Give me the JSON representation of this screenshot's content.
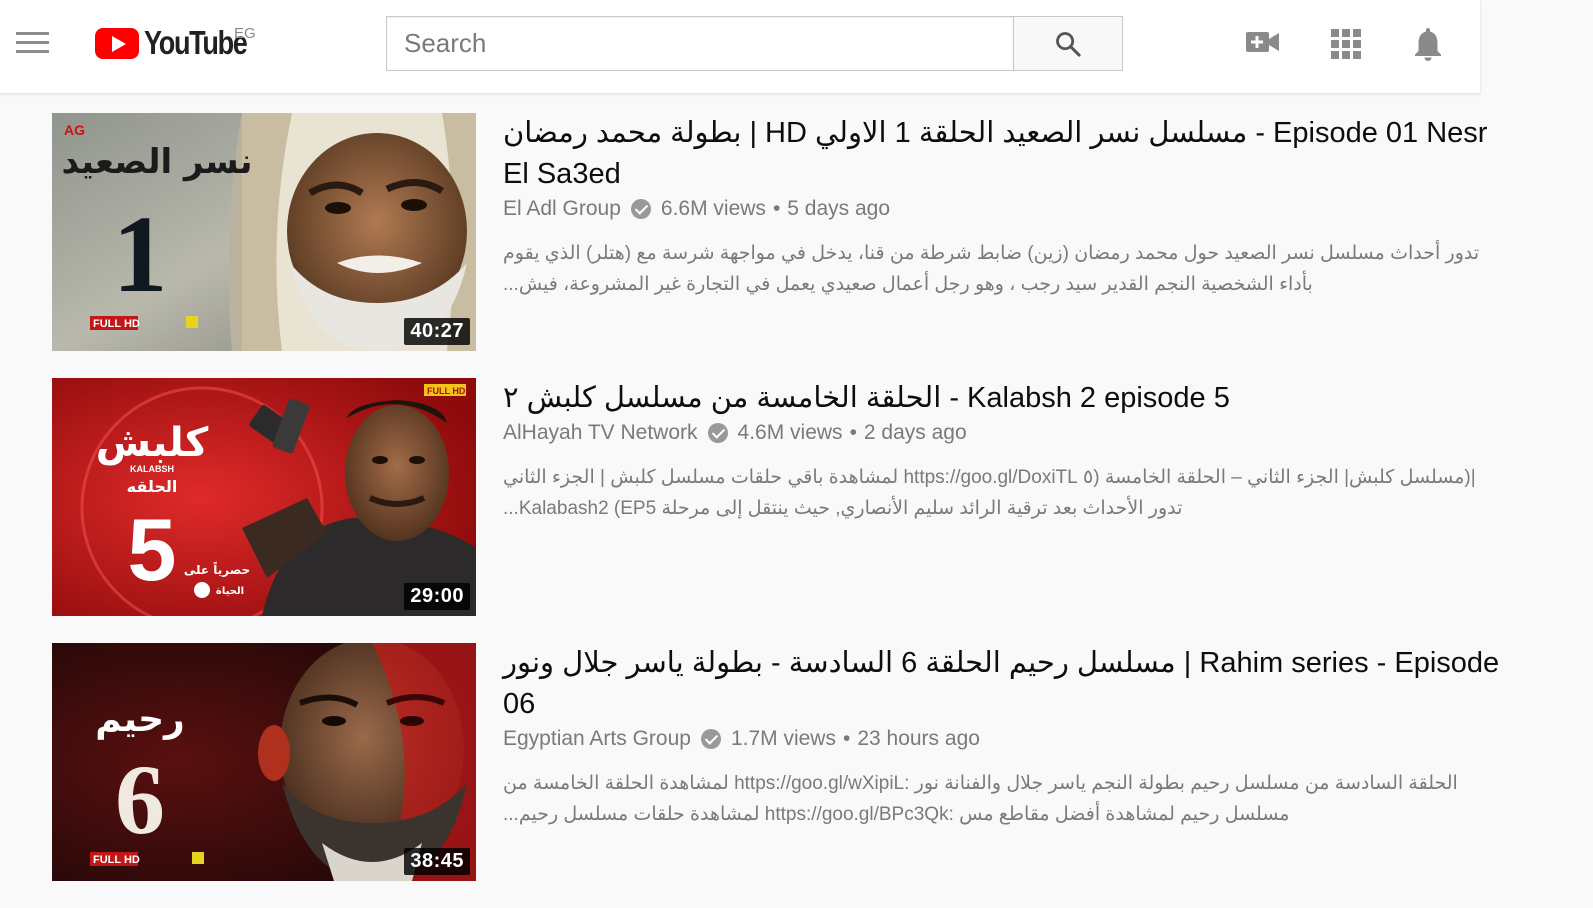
{
  "header": {
    "logo_text": "YouTube",
    "country_code": "EG",
    "search_placeholder": "Search",
    "brand_color": "#ff0000",
    "icons": [
      "menu-icon",
      "search-icon",
      "video-camera-plus-icon",
      "apps-grid-icon",
      "bell-icon"
    ]
  },
  "results": [
    {
      "title": "بطولة محمد رمضان | HD مسلسل نسر الصعيد الحلقة 1 الاولي - Episode 01 Nesr El Sa3ed",
      "channel": "El Adl Group",
      "views": "6.6M views",
      "age": "5 days ago",
      "description": "تدور أحداث مسلسل نسر الصعيد حول محمد رمضان (زين) ضابط شرطة من قنا، يدخل في مواجهة شرسة مع (هتلر) الذي يقوم بأداء الشخصية النجم القدير سيد رجب ، وهو رجل أعمال صعيدي يعمل في التجارة غير المشروعة، فيش...",
      "duration": "40:27",
      "thumb_text": "نسر الصعيد",
      "thumb_number": "1",
      "thumb_badges": [
        "AG",
        "FULL HD"
      ]
    },
    {
      "title": "الحلقة الخامسة من مسلسل كلبش ٢ - Kalabsh 2 episode 5",
      "channel": "AlHayah TV Network",
      "views": "4.6M views",
      "age": "2 days ago",
      "description": "|(مسلسل كلبش| الجزء الثاني – الحلقة الخامسة (٥ https://goo.gl/DoxiTL لمشاهدة باقي حلقات مسلسل كلبش | الجزء الثاني تدور الأحداث بعد ترقية الرائد سليم الأنصاري, حيث ينتقل إلى مرحلة Kalabash2 (EP5...",
      "duration": "29:00",
      "thumb_text": "كلبش",
      "thumb_sub": "KALABSH",
      "thumb_label": "الحلقه",
      "thumb_number": "5",
      "thumb_excl": "حصرياً على",
      "thumb_channel": "الحياة",
      "thumb_badges": [
        "FULL HD"
      ]
    },
    {
      "title": "مسلسل رحيم الحلقة 6 السادسة - بطولة ياسر جلال ونور | Rahim series - Episode 06",
      "channel": "Egyptian Arts Group",
      "views": "1.7M views",
      "age": "23 hours ago",
      "description": "الحلقة السادسة من مسلسل رحيم بطولة النجم ياسر جلال والفنانة نور :https://goo.gl/wXipiL لمشاهدة الحلقة الخامسة من مسلسل رحيم لمشاهدة أفضل مقاطع مس :https://goo.gl/BPc3Qk لمشاهدة حلقات مسلسل رحيم...",
      "duration": "38:45",
      "thumb_text": "رحيم",
      "thumb_number": "6",
      "thumb_badges": [
        "FULL HD"
      ]
    }
  ]
}
